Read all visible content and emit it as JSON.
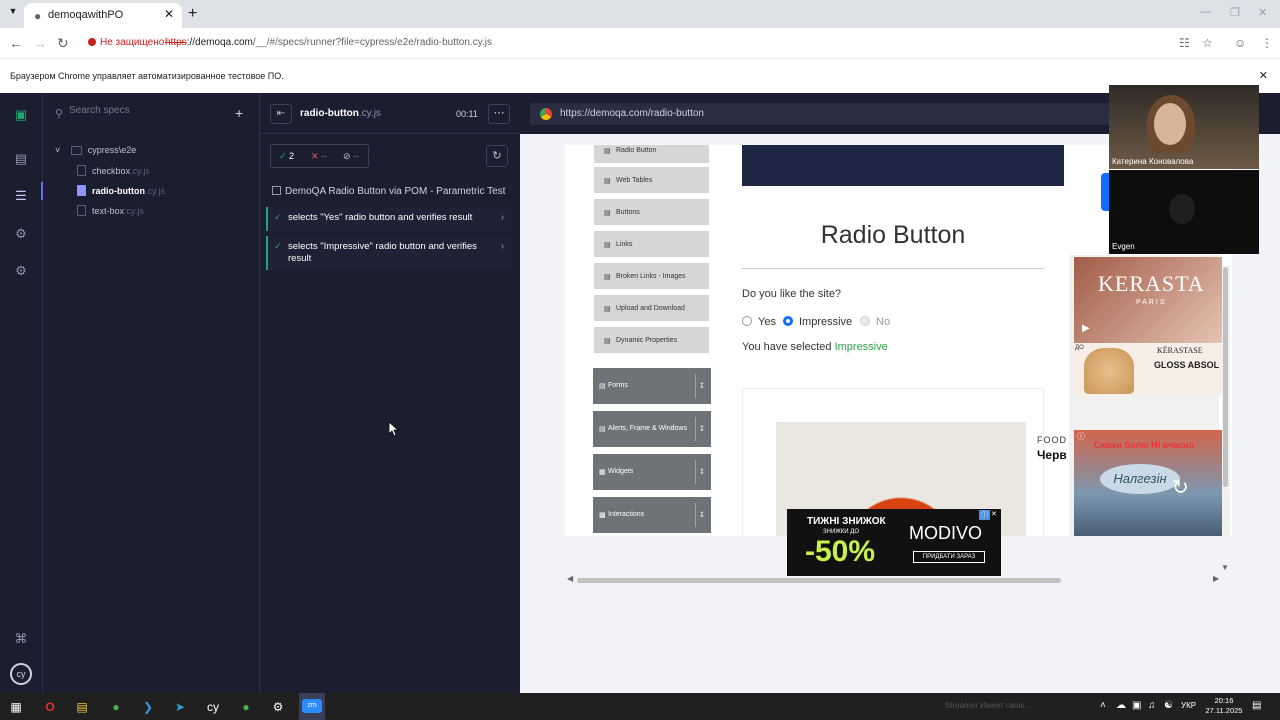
{
  "browser": {
    "tab_title": "demoqawithPO",
    "security_label": "Не защищено",
    "url_scheme": "https",
    "url_host": "://demoqa.com",
    "url_path": "/__/#/specs/runner?file=cypress/e2e/radio-button.cy.js",
    "infobar_message": "Браузером Chrome управляет автоматизированное тестовое ПО."
  },
  "specs_panel": {
    "search_placeholder": "Search specs",
    "folder": "cypress\\e2e",
    "files": [
      {
        "name": "checkbox",
        "ext": ".cy.js",
        "active": false
      },
      {
        "name": "radio-button",
        "ext": ".cy.js",
        "active": true
      },
      {
        "name": "text-box",
        "ext": ".cy.js",
        "active": false
      }
    ]
  },
  "reporter": {
    "spec_name": "radio-button",
    "spec_ext": ".cy.js",
    "timer": "00:11",
    "passed": "2",
    "failed": "--",
    "pending": "--",
    "suite_title": "DemoQA Radio Button via POM - Parametric Test",
    "tests": [
      {
        "title": "selects \"Yes\" radio button and verifies result",
        "state": "passed"
      },
      {
        "title": "selects \"Impressive\" radio button and verifies result",
        "state": "passed"
      }
    ]
  },
  "aut": {
    "url": "https://demoqa.com/radio-button",
    "menu_items": [
      "Radio Button",
      "Web Tables",
      "Buttons",
      "Links",
      "Broken Links - Images",
      "Upload and Download",
      "Dynamic Properties"
    ],
    "menu_groups": [
      "Forms",
      "Alerts, Frame & Windows",
      "Widgets",
      "Interactions"
    ],
    "page_title": "Radio Button",
    "question": "Do you like the site?",
    "options": [
      {
        "label": "Yes",
        "checked": false,
        "disabled": false
      },
      {
        "label": "Impressive",
        "checked": true,
        "disabled": false
      },
      {
        "label": "No",
        "checked": false,
        "disabled": true
      }
    ],
    "result_prefix": "You have selected",
    "result_value": "Impressive",
    "ads": {
      "food": "FOOD",
      "food_sub": "Черв",
      "sale_line1": "ТИЖНІ ЗНИЖОК",
      "sale_line2": "ЗНИЖКИ ДО",
      "sale_percent": "-50%",
      "sale_brand": "MODIVO",
      "sale_cta": "ПРИДБАТИ ЗАРАЗ",
      "kerastase": "KERASTA",
      "kerastase_sub": "PARIS",
      "gloss_brand": "KÉRASTASE",
      "gloss_text": "GLOSS ABSOL",
      "gloss_small": "ДО",
      "pain_text": "Скажи болю НІ вчасно",
      "pain_brand": "Налгезін"
    }
  },
  "video": {
    "participant1": "Катерина Коновалова",
    "participant2": "Evgen"
  },
  "taskbar": {
    "notice": "Streamer Имеет свою...",
    "lang": "УКР",
    "time": "20:16",
    "date": "27.11.2025"
  },
  "colors": {
    "cypress_bg": "#1b1e2e",
    "pass_green": "#1fa971",
    "accent": "#6470f3"
  }
}
